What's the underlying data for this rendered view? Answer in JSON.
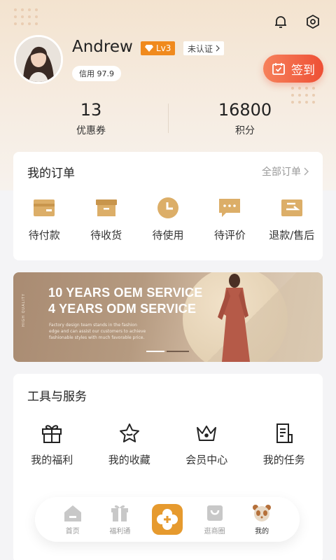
{
  "profile": {
    "name": "Andrew",
    "level": "Lv3",
    "verify": "未认证",
    "credit": "信用 97.9"
  },
  "signin_label": "签到",
  "stats": [
    {
      "value": "13",
      "label": "优惠券"
    },
    {
      "value": "16800",
      "label": "积分"
    }
  ],
  "orders": {
    "title": "我的订单",
    "all_label": "全部订单",
    "items": [
      {
        "label": "待付款",
        "icon": "wallet-icon"
      },
      {
        "label": "待收货",
        "icon": "box-icon"
      },
      {
        "label": "待使用",
        "icon": "clock-icon"
      },
      {
        "label": "待评价",
        "icon": "comment-icon"
      },
      {
        "label": "退款/售后",
        "icon": "refund-icon"
      }
    ]
  },
  "banner": {
    "line1": "10 YEARS OEM SERVICE",
    "line2": "4 YEARS ODM SERVICE",
    "small": "Factory design team stands in the fashion edge and can assist our customers to achieve fashionable styles with much favorable price.",
    "vertical": "HIGH QUALITY"
  },
  "tools": {
    "title": "工具与服务",
    "items": [
      {
        "label": "我的福利",
        "icon": "gift-icon"
      },
      {
        "label": "我的收藏",
        "icon": "star-icon"
      },
      {
        "label": "会员中心",
        "icon": "crown-icon"
      },
      {
        "label": "我的任务",
        "icon": "task-icon"
      }
    ]
  },
  "tabs": [
    {
      "label": "首页",
      "icon": "home-icon"
    },
    {
      "label": "福利通",
      "icon": "gift-box-icon"
    },
    {
      "label": "",
      "icon": "plus-clover-icon"
    },
    {
      "label": "逛商圈",
      "icon": "shopping-bag-icon"
    },
    {
      "label": "我的",
      "icon": "panda-icon"
    }
  ],
  "colors": {
    "accent": "#f08a1d",
    "signin": "#ee4f35",
    "icon_gold": "#d9a35a"
  }
}
